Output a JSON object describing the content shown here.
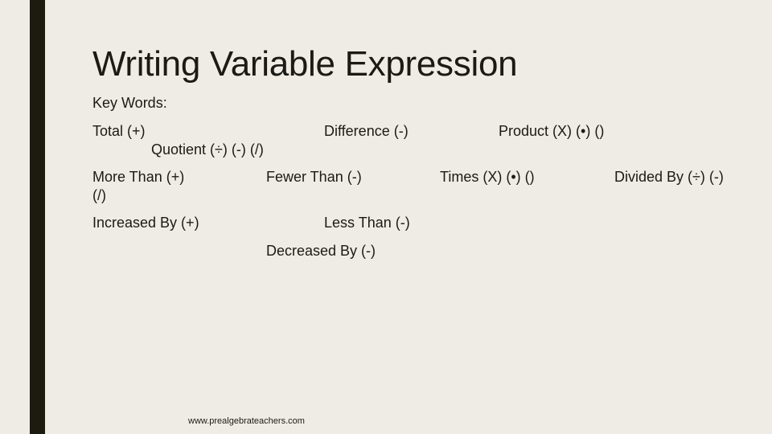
{
  "slide": {
    "title": "Writing Variable Expression",
    "subtitle": "Key Words:",
    "accent_color": "#1c1b0f",
    "background_color": "#efece6",
    "keywords": [
      {
        "text": "Total (+)",
        "operation": "addition"
      },
      {
        "text": "Quotient (÷) (-) (/)",
        "operation": "division"
      },
      {
        "text": "Difference (-)",
        "operation": "subtraction"
      },
      {
        "text": "Product (X) (•) ()",
        "operation": "multiplication"
      },
      {
        "text": "More Than (+)",
        "operation": "addition"
      },
      {
        "text": "(/)",
        "operation": "division"
      },
      {
        "text": "Fewer Than (-)",
        "operation": "subtraction"
      },
      {
        "text": "Times (X) (•) ()",
        "operation": "multiplication"
      },
      {
        "text": "Divided By (÷) (-)",
        "operation": "division"
      },
      {
        "text": "Increased By (+)",
        "operation": "addition"
      },
      {
        "text": "Less Than (-)",
        "operation": "subtraction"
      },
      {
        "text": "Decreased By (-)",
        "operation": "subtraction"
      }
    ],
    "footer": "www.prealgebrateachers.com"
  }
}
